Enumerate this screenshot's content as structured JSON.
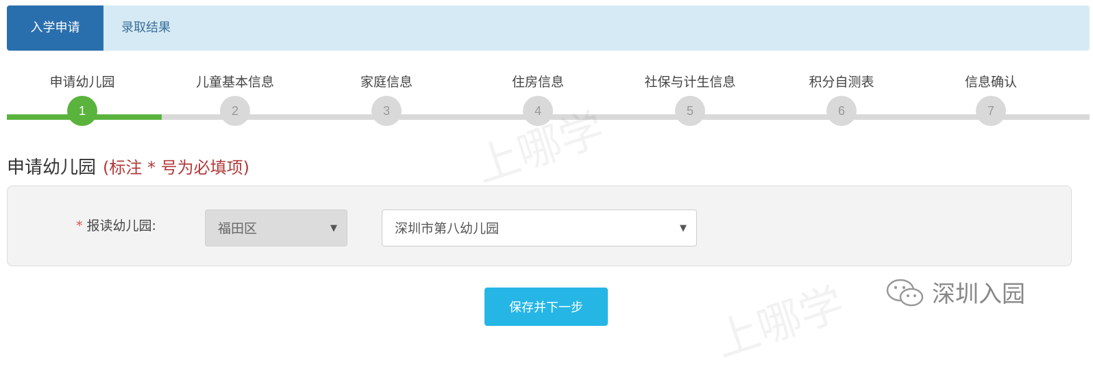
{
  "tabs": {
    "active_label": "入学申请",
    "second_label": "录取结果"
  },
  "steps": [
    {
      "label": "申请幼儿园",
      "num": "1",
      "done": true
    },
    {
      "label": "儿童基本信息",
      "num": "2",
      "done": false
    },
    {
      "label": "家庭信息",
      "num": "3",
      "done": false
    },
    {
      "label": "住房信息",
      "num": "4",
      "done": false
    },
    {
      "label": "社保与计生信息",
      "num": "5",
      "done": false
    },
    {
      "label": "积分自测表",
      "num": "6",
      "done": false
    },
    {
      "label": "信息确认",
      "num": "7",
      "done": false
    }
  ],
  "section": {
    "title": "申请幼儿园",
    "note": "(标注 * 号为必填项)"
  },
  "form": {
    "required_mark": "*",
    "label": "报读幼儿园:",
    "district_value": "福田区",
    "kindergarten_value": "深圳市第八幼儿园",
    "caret": "▼"
  },
  "actions": {
    "submit_label": "保存并下一步"
  },
  "watermark": {
    "text": "深圳入园",
    "ghost": "上哪学"
  },
  "colors": {
    "active_tab": "#2a6fad",
    "tabbar_bg": "#d6eaf5",
    "step_done": "#5ab33c",
    "step_pending": "#d9d9d9",
    "required": "#d9534f",
    "primary_button": "#25b6e6"
  }
}
